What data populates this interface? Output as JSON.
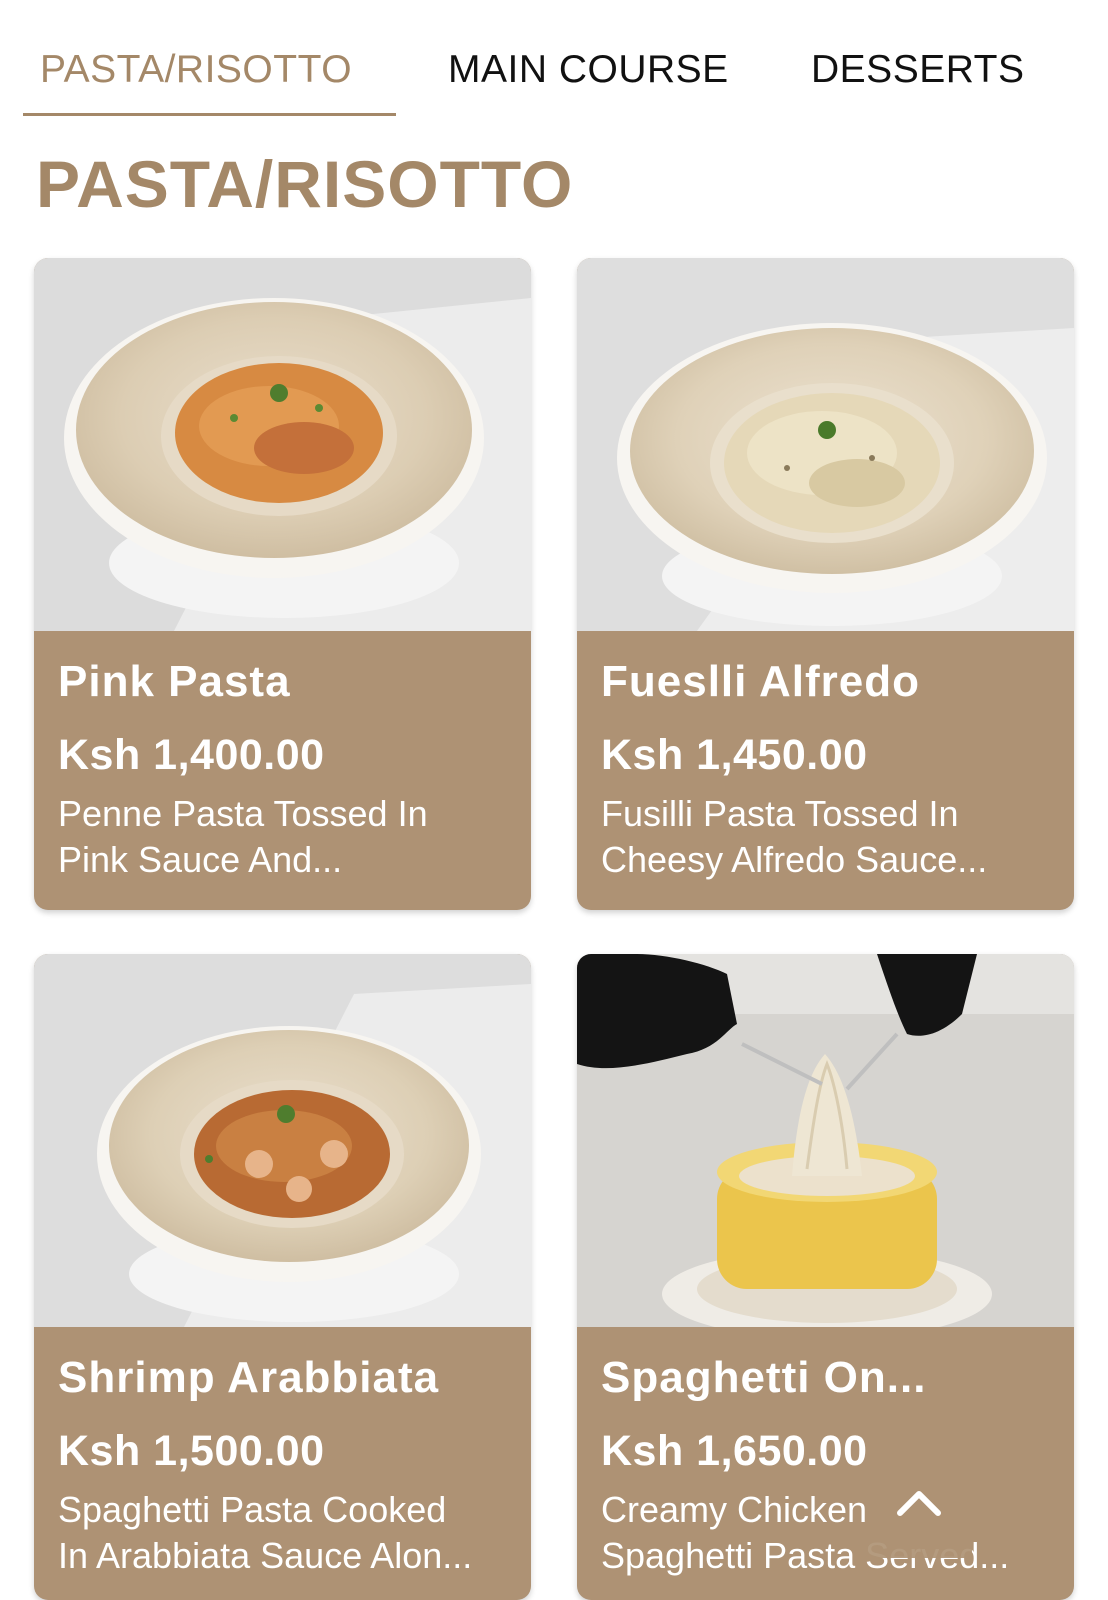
{
  "tabs": [
    {
      "label": "PASTA/RISOTTO",
      "active": true
    },
    {
      "label": "MAIN COURSE",
      "active": false
    },
    {
      "label": "DESSERTS",
      "active": false
    }
  ],
  "section": {
    "title": "PASTA/RISOTTO"
  },
  "items": [
    {
      "name": "Pink Pasta",
      "price": "Ksh 1,400.00",
      "description": "Penne Pasta Tossed In\nPink Sauce And..."
    },
    {
      "name": "Fueslli Alfredo",
      "price": "Ksh 1,450.00",
      "description": "Fusilli Pasta Tossed In\nCheesy Alfredo Sauce..."
    },
    {
      "name": "Shrimp Arabbiata",
      "price": "Ksh 1,500.00",
      "description": "Spaghetti Pasta Cooked\nIn Arabbiata Sauce Alon..."
    },
    {
      "name": "Spaghetti On...",
      "price": "Ksh 1,650.00",
      "description": "Creamy Chicken\nSpaghetti Pasta Served..."
    }
  ],
  "colors": {
    "accent": "#a48868",
    "card_background": "#ae9274",
    "text_dark": "#111111",
    "text_light": "#ffffff"
  },
  "icons": {
    "scroll_top": "chevron-up-icon"
  }
}
